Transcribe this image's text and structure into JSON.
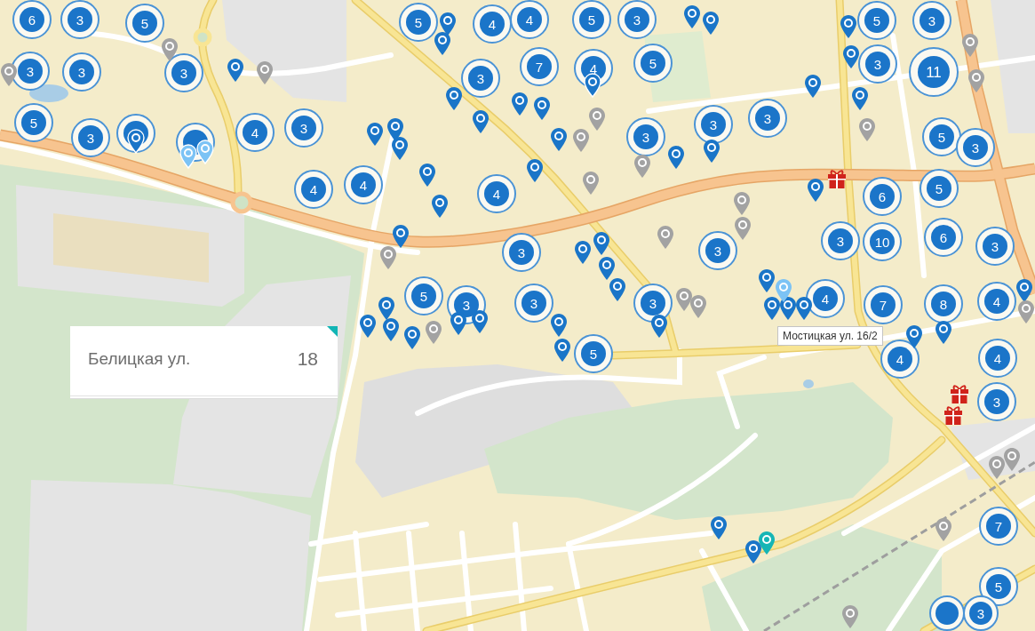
{
  "map": {
    "clusters": [
      {
        "kind": "number",
        "count": "6"
      },
      {
        "kind": "number",
        "count": "3"
      },
      {
        "kind": "number",
        "count": "5"
      },
      {
        "kind": "number",
        "count": "3"
      },
      {
        "kind": "number",
        "count": "3"
      },
      {
        "kind": "number",
        "count": "3"
      },
      {
        "kind": "number",
        "count": "5"
      },
      {
        "kind": "number",
        "count": "3"
      },
      {
        "kind": "plain"
      },
      {
        "kind": "plain"
      },
      {
        "kind": "number",
        "count": "4"
      },
      {
        "kind": "number",
        "count": "3"
      },
      {
        "kind": "number",
        "count": "4"
      },
      {
        "kind": "number",
        "count": "5"
      },
      {
        "kind": "number",
        "count": "4"
      },
      {
        "kind": "number",
        "count": "4"
      },
      {
        "kind": "number",
        "count": "5"
      },
      {
        "kind": "number",
        "count": "3"
      },
      {
        "kind": "number",
        "count": "3"
      },
      {
        "kind": "number",
        "count": "7"
      },
      {
        "kind": "number",
        "count": "4"
      },
      {
        "kind": "number",
        "count": "5"
      },
      {
        "kind": "number",
        "count": "3"
      },
      {
        "kind": "number",
        "count": "4"
      },
      {
        "kind": "number",
        "count": "4"
      },
      {
        "kind": "number",
        "count": "3"
      },
      {
        "kind": "number",
        "count": "5"
      },
      {
        "kind": "number",
        "count": "3"
      },
      {
        "kind": "number",
        "count": "3"
      },
      {
        "kind": "number",
        "count": "3"
      },
      {
        "kind": "number",
        "count": "5"
      },
      {
        "kind": "number",
        "count": "3"
      },
      {
        "kind": "number",
        "count": "3"
      },
      {
        "kind": "number",
        "count": "11"
      },
      {
        "kind": "number",
        "count": "3"
      },
      {
        "kind": "number",
        "count": "3"
      },
      {
        "kind": "number",
        "count": "5"
      },
      {
        "kind": "number",
        "count": "3"
      },
      {
        "kind": "number",
        "count": "6"
      },
      {
        "kind": "number",
        "count": "5"
      },
      {
        "kind": "number",
        "count": "3"
      },
      {
        "kind": "number",
        "count": "3"
      },
      {
        "kind": "number",
        "count": "10"
      },
      {
        "kind": "number",
        "count": "6"
      },
      {
        "kind": "number",
        "count": "3"
      },
      {
        "kind": "number",
        "count": "4"
      },
      {
        "kind": "number",
        "count": "7"
      },
      {
        "kind": "number",
        "count": "8"
      },
      {
        "kind": "number",
        "count": "4"
      },
      {
        "kind": "number",
        "count": "5"
      },
      {
        "kind": "number",
        "count": "4"
      },
      {
        "kind": "number",
        "count": "4"
      },
      {
        "kind": "number",
        "count": "3"
      },
      {
        "kind": "number",
        "count": "7"
      },
      {
        "kind": "plain"
      },
      {
        "kind": "number",
        "count": "5"
      },
      {
        "kind": "number",
        "count": "3"
      }
    ],
    "pins": [
      {
        "color": "#1a75c8"
      },
      {
        "color": "#1a75c8"
      },
      {
        "color": "#1a75c8"
      },
      {
        "color": "#1a75c8"
      },
      {
        "color": "#1a75c8"
      },
      {
        "color": "#1a75c8"
      },
      {
        "color": "#1a75c8"
      },
      {
        "color": "#1a75c8"
      },
      {
        "color": "#1a75c8"
      },
      {
        "color": "#1a75c8"
      },
      {
        "color": "#1a75c8"
      },
      {
        "color": "#1a75c8"
      },
      {
        "color": "#1a75c8"
      },
      {
        "color": "#1a75c8"
      },
      {
        "color": "#1a75c8"
      },
      {
        "color": "#1a75c8"
      },
      {
        "color": "#1a75c8"
      },
      {
        "color": "#1a75c8"
      },
      {
        "color": "#1a75c8"
      },
      {
        "color": "#1a75c8"
      },
      {
        "color": "#1a75c8"
      },
      {
        "color": "#1a75c8"
      },
      {
        "color": "#1a75c8"
      },
      {
        "color": "#1a75c8"
      },
      {
        "color": "#1a75c8"
      },
      {
        "color": "#1a75c8"
      },
      {
        "color": "#1a75c8"
      },
      {
        "color": "#1a75c8"
      },
      {
        "color": "#1a75c8"
      },
      {
        "color": "#1a75c8"
      },
      {
        "color": "#1a75c8"
      },
      {
        "color": "#1a75c8"
      },
      {
        "color": "#1a75c8"
      },
      {
        "color": "#1a75c8"
      },
      {
        "color": "#1a75c8"
      },
      {
        "color": "#1a75c8"
      },
      {
        "color": "#1a75c8"
      },
      {
        "color": "#1a75c8"
      },
      {
        "color": "#1a75c8"
      },
      {
        "color": "#1a75c8"
      },
      {
        "color": "#1a75c8"
      },
      {
        "color": "#1a75c8"
      },
      {
        "color": "#1a75c8"
      },
      {
        "color": "#1a75c8"
      },
      {
        "color": "#1a75c8"
      },
      {
        "color": "#1a75c8"
      },
      {
        "color": "#1a75c8"
      },
      {
        "color": "#1a75c8"
      },
      {
        "color": "#7cc3f5"
      },
      {
        "color": "#7cc3f5"
      },
      {
        "color": "#7cc3f5"
      },
      {
        "color": "#16b5b5"
      },
      {
        "color": "#a2a2a2"
      },
      {
        "color": "#a2a2a2"
      },
      {
        "color": "#a2a2a2"
      },
      {
        "color": "#a2a2a2"
      },
      {
        "color": "#a2a2a2"
      },
      {
        "color": "#a2a2a2"
      },
      {
        "color": "#a2a2a2"
      },
      {
        "color": "#a2a2a2"
      },
      {
        "color": "#a2a2a2"
      },
      {
        "color": "#a2a2a2"
      },
      {
        "color": "#a2a2a2"
      },
      {
        "color": "#a2a2a2"
      },
      {
        "color": "#a2a2a2"
      },
      {
        "color": "#a2a2a2"
      },
      {
        "color": "#a2a2a2"
      },
      {
        "color": "#a2a2a2"
      },
      {
        "color": "#a2a2a2"
      },
      {
        "color": "#a2a2a2"
      },
      {
        "color": "#a2a2a2"
      },
      {
        "color": "#a2a2a2"
      },
      {
        "color": "#a2a2a2"
      },
      {
        "color": "#a2a2a2"
      }
    ]
  },
  "info_card": {
    "street": "Белицкая ул.",
    "number": "18"
  },
  "tooltip": {
    "text": "Мостицкая ул. 16/2"
  }
}
